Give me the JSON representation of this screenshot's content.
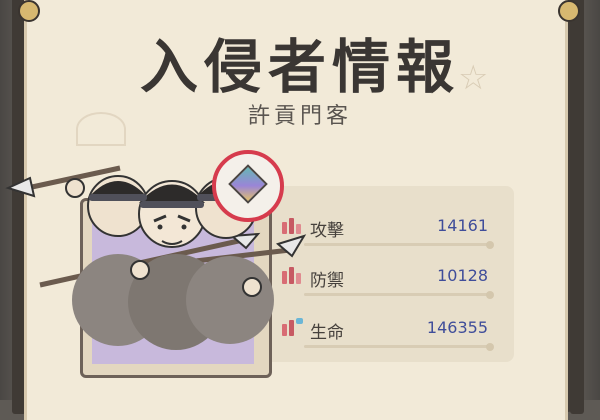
{
  "title": "入侵者情報",
  "subtitle": "許貢門客",
  "stats": [
    {
      "label": "攻擊",
      "value": "14161"
    },
    {
      "label": "防禦",
      "value": "10128"
    },
    {
      "label": "生命",
      "value": "146355"
    }
  ],
  "icons": {
    "attack": "sword-icon",
    "defense": "shield-icon",
    "health": "heart-icon",
    "target": "target-icon"
  },
  "colors": {
    "accent_red": "#d63b4d",
    "value_blue": "#3f4d9a",
    "paper": "#f2ead8"
  }
}
